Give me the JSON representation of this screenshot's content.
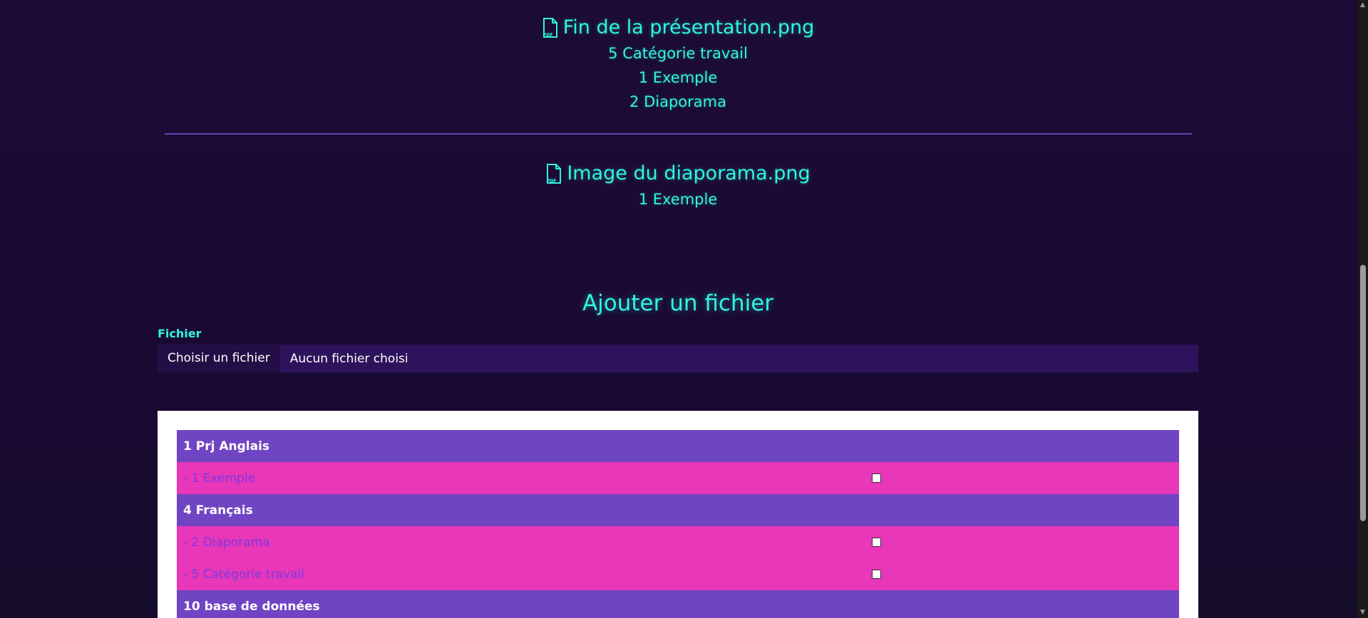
{
  "files": [
    {
      "name": "Fin de la présentation.png",
      "icon": "pdf-file-icon",
      "categories": [
        "5 Catégorie travail",
        "1 Exemple",
        "2 Diaporama"
      ]
    },
    {
      "name": "Image du diaporama.png",
      "icon": "pdf-file-icon",
      "categories": [
        "1 Exemple"
      ]
    }
  ],
  "upload": {
    "title": "Ajouter un fichier",
    "field_label": "Fichier",
    "button_label": "Choisir un fichier",
    "status": "Aucun fichier choisi"
  },
  "category_table": {
    "rows": [
      {
        "type": "category",
        "label": "1 Prj Anglais"
      },
      {
        "type": "item",
        "label": "- 1 Exemple",
        "checked": false
      },
      {
        "type": "category",
        "label": "4 Français"
      },
      {
        "type": "item",
        "label": "- 2 Diaporama",
        "checked": false
      },
      {
        "type": "item",
        "label": "- 5 Catégorie travail",
        "checked": false
      },
      {
        "type": "category",
        "label": "10 base de données"
      }
    ]
  },
  "colors": {
    "background": "#1c0b34",
    "accent_text": "#2ff5e0",
    "category_row": "#7045c4",
    "item_row": "#e837b8",
    "item_text": "#7a3ae0",
    "divider": "#6a3fb8"
  }
}
